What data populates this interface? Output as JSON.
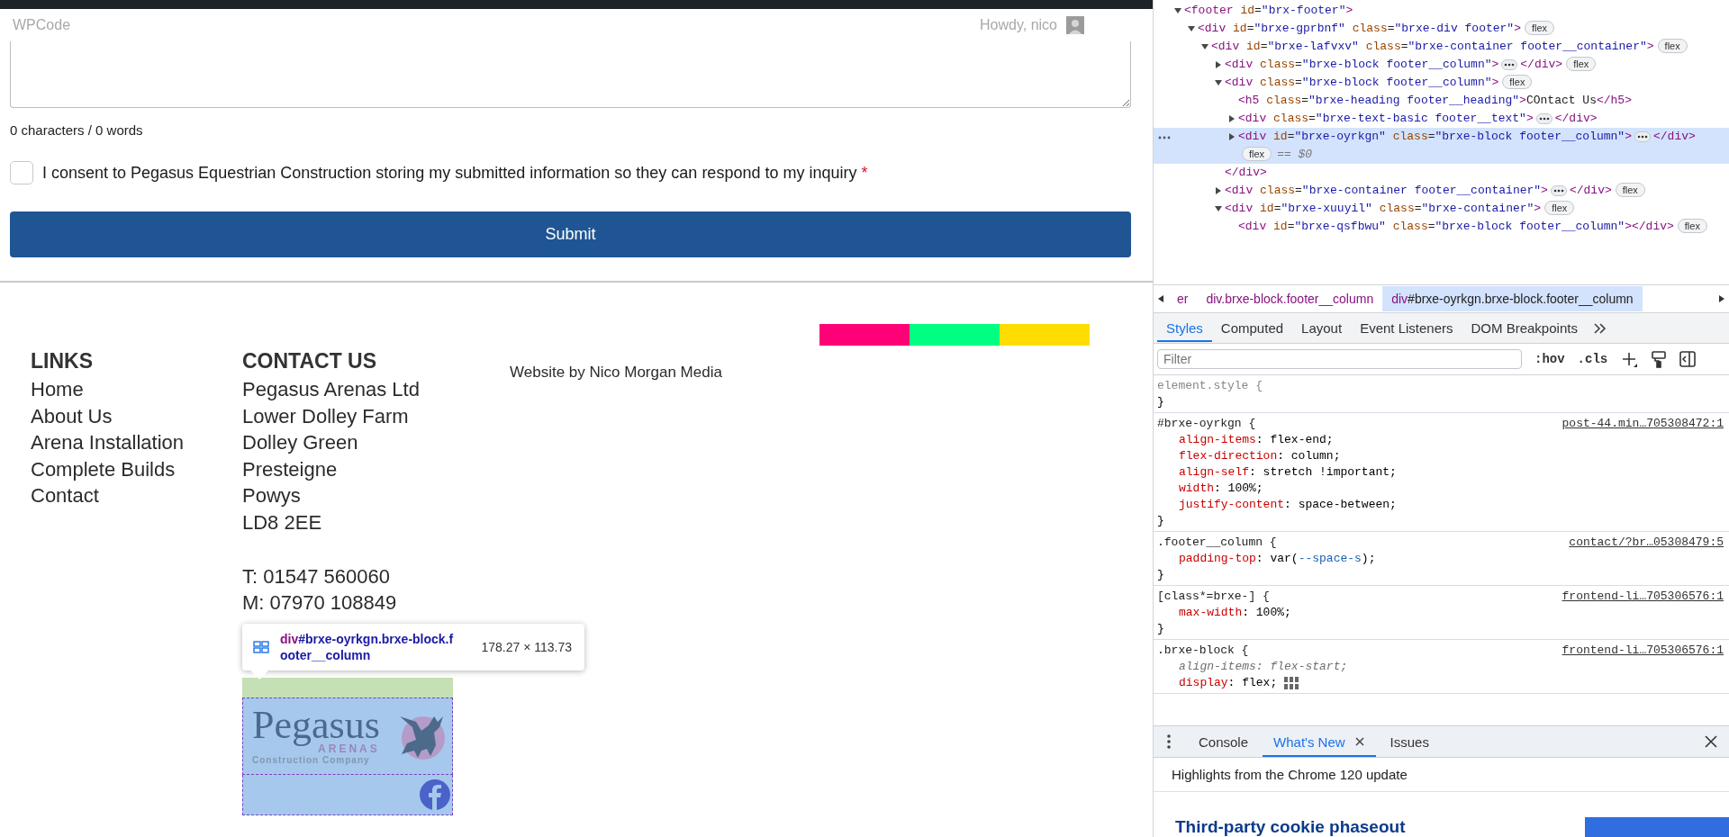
{
  "page": {
    "admin_ghost": {
      "left": "WPCode",
      "right": "Howdy, nico"
    },
    "form": {
      "counter": "0 characters / 0 words",
      "consent": {
        "label": "I consent to Pegasus Equestrian Construction storing my submitted information so they can respond to my inquiry",
        "required_mark": "*",
        "checked": false
      },
      "submit": "Submit"
    },
    "footer": {
      "links": {
        "heading": "LINKS",
        "items": [
          "Home",
          "About Us",
          "Arena Installation",
          "Complete Builds",
          "Contact"
        ]
      },
      "contact": {
        "heading": "CONTACT US",
        "address": [
          "Pegasus Arenas Ltd",
          "Lower Dolley Farm",
          "Dolley Green",
          "Presteigne",
          "Powys",
          "LD8 2EE"
        ],
        "phones": [
          "T: 01547 560060",
          "M: 07970 108849"
        ]
      },
      "credit": "Website by Nico Morgan Media",
      "color_strip": [
        {
          "color": "#ff0077"
        },
        {
          "color": "#00ff80"
        },
        {
          "color": "#ffdd00"
        }
      ],
      "logo": {
        "name": "Pegasus",
        "sub": "ARENAS",
        "tagline": "Construction Company"
      },
      "inspect_tooltip": {
        "selector": "div#brxe-oyrkgn.brxe-block.footer__column",
        "size": "178.27 × 113.73"
      }
    }
  },
  "devtools": {
    "elements": [
      {
        "kind": "expandable",
        "expanded": true,
        "open": "<footer id=\"brx-footer\">",
        "children": [
          {
            "kind": "expandable",
            "expanded": true,
            "open": "<div id=\"brxe-gprbnf\" class=\"brxe-div footer\">",
            "badge": "flex",
            "children": [
              {
                "kind": "expandable",
                "expanded": true,
                "open": "<div id=\"brxe-lafvxv\" class=\"brxe-container footer__container\">",
                "badge": "flex",
                "children": [
                  {
                    "kind": "expandable",
                    "expanded": false,
                    "open": "<div class=\"brxe-block footer__column\">",
                    "close": "</div>",
                    "badge": "flex",
                    "selected": false
                  },
                  {
                    "kind": "expandable",
                    "expanded": true,
                    "open": "<div class=\"brxe-block footer__column\">",
                    "badge": "flex",
                    "close_line": "</div>",
                    "children": [
                      {
                        "kind": "leaf",
                        "open": "<h5 class=\"brxe-heading footer__heading\">COntact Us</h5>",
                        "selected": false
                      },
                      {
                        "kind": "expandable",
                        "expanded": false,
                        "open": "<div class=\"brxe-text-basic footer__text\">",
                        "close": "</div>",
                        "selected": false
                      },
                      {
                        "kind": "expandable",
                        "expanded": false,
                        "open": "<div id=\"brxe-oyrkgn\" class=\"brxe-block footer__column\">",
                        "close": "</div>",
                        "badge": "flex",
                        "console_ref": "== $0",
                        "selected": true
                      }
                    ]
                  },
                  {
                    "kind": "expandable",
                    "expanded": false,
                    "open": "<div class=\"brxe-container footer__container\">",
                    "close": "</div>",
                    "badge": "flex",
                    "selected": false
                  },
                  {
                    "kind": "expandable",
                    "expanded": true,
                    "open": "<div id=\"brxe-xuuyil\" class=\"brxe-container\">",
                    "badge": "flex",
                    "children": [
                      {
                        "kind": "leaf",
                        "open": "<div id=\"brxe-qsfbwu\" class=\"brxe-block footer__column\">",
                        "close": "</div>",
                        "badge": "flex",
                        "selected": false
                      }
                    ]
                  }
                ]
              }
            ]
          }
        ]
      }
    ],
    "breadcrumbs": [
      {
        "label": "er",
        "selected": false
      },
      {
        "label": "div.brxe-block.footer__column",
        "selected": false
      },
      {
        "label": "div#brxe-oyrkgn.brxe-block.footer__column",
        "selected": true
      }
    ],
    "tabs": [
      {
        "label": "Styles",
        "selected": true
      },
      {
        "label": "Computed",
        "selected": false
      },
      {
        "label": "Layout",
        "selected": false
      },
      {
        "label": "Event Listeners",
        "selected": false
      },
      {
        "label": "DOM Breakpoints",
        "selected": false
      }
    ],
    "filter": {
      "placeholder": "Filter"
    },
    "toggles": [
      ":hov",
      ".cls"
    ],
    "rules": [
      {
        "kind": "inline",
        "selector": "element.style {",
        "close": "}"
      },
      {
        "kind": "rule",
        "selector": "#brxe-oyrkgn {",
        "source": "post-44.min…705308472:1",
        "close": "}",
        "declarations": [
          {
            "text": "align-items: flex-end;",
            "overridden": false
          },
          {
            "text": "flex-direction: column;",
            "overridden": false
          },
          {
            "text": "align-self: stretch !important;",
            "overridden": false
          },
          {
            "text": "width: 100%;",
            "overridden": false
          },
          {
            "text": "justify-content: space-between;",
            "overridden": false
          }
        ]
      },
      {
        "kind": "rule",
        "selector": ".footer__column {",
        "source": "contact/?br…05308479:5",
        "close": "}",
        "declarations": [
          {
            "text": "padding-top: var(--space-s);",
            "overridden": false
          }
        ]
      },
      {
        "kind": "rule",
        "selector": "[class*=brxe-] {",
        "source": "frontend-li…705306576:1",
        "close": "}",
        "declarations": [
          {
            "text": "max-width: 100%;",
            "overridden": false
          }
        ]
      },
      {
        "kind": "rule",
        "selector": ".brxe-block {",
        "source": "frontend-li…705306576:1",
        "declarations": [
          {
            "text": "align-items: flex-start;",
            "overridden": true
          },
          {
            "text": "display: flex;",
            "overridden": false,
            "flex_editor": true
          }
        ]
      }
    ],
    "drawer": {
      "tabs": [
        {
          "label": "Console",
          "selected": false,
          "closable": false
        },
        {
          "label": "What's New",
          "selected": true,
          "closable": true
        },
        {
          "label": "Issues",
          "selected": false,
          "closable": false
        }
      ],
      "headline": "Highlights from the Chrome 120 update",
      "article_title": "Third-party cookie phaseout"
    }
  }
}
